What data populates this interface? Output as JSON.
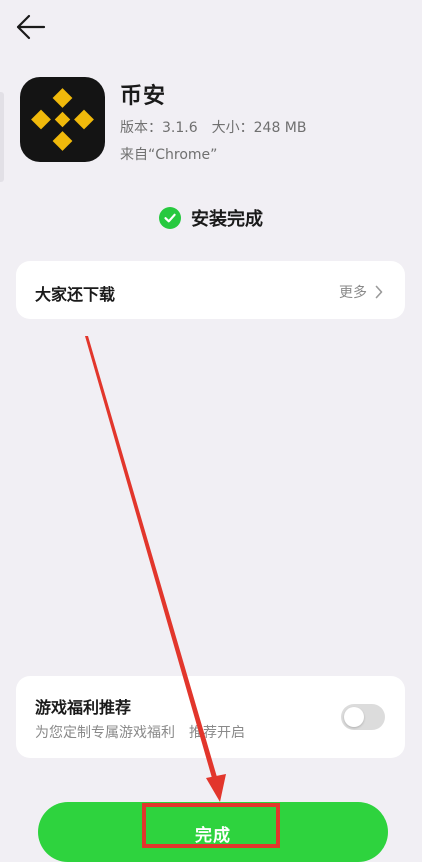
{
  "app": {
    "name": "币安",
    "version_label": "版本：",
    "version_value": "3.1.6",
    "size_label": "大小：",
    "size_value": "248 MB",
    "source": "来自“Chrome”"
  },
  "status": {
    "text": "安装完成"
  },
  "download_section": {
    "title": "大家还下载",
    "more_label": "更多"
  },
  "game_section": {
    "title": "游戏福利推荐",
    "subtitle_part1": "为您定制专属游戏福利",
    "subtitle_part2": "推荐开启",
    "toggle_on": false
  },
  "done_button": {
    "label": "完成"
  },
  "colors": {
    "background": "#f1eff4",
    "accent_green": "#2ed33e",
    "check_green": "#27c93f",
    "annotation_red": "#e2362c",
    "brand_yellow": "#f0b90b"
  },
  "icons": [
    "back-arrow-icon",
    "binance-logo-icon",
    "check-circle-icon",
    "chevron-right-icon"
  ]
}
